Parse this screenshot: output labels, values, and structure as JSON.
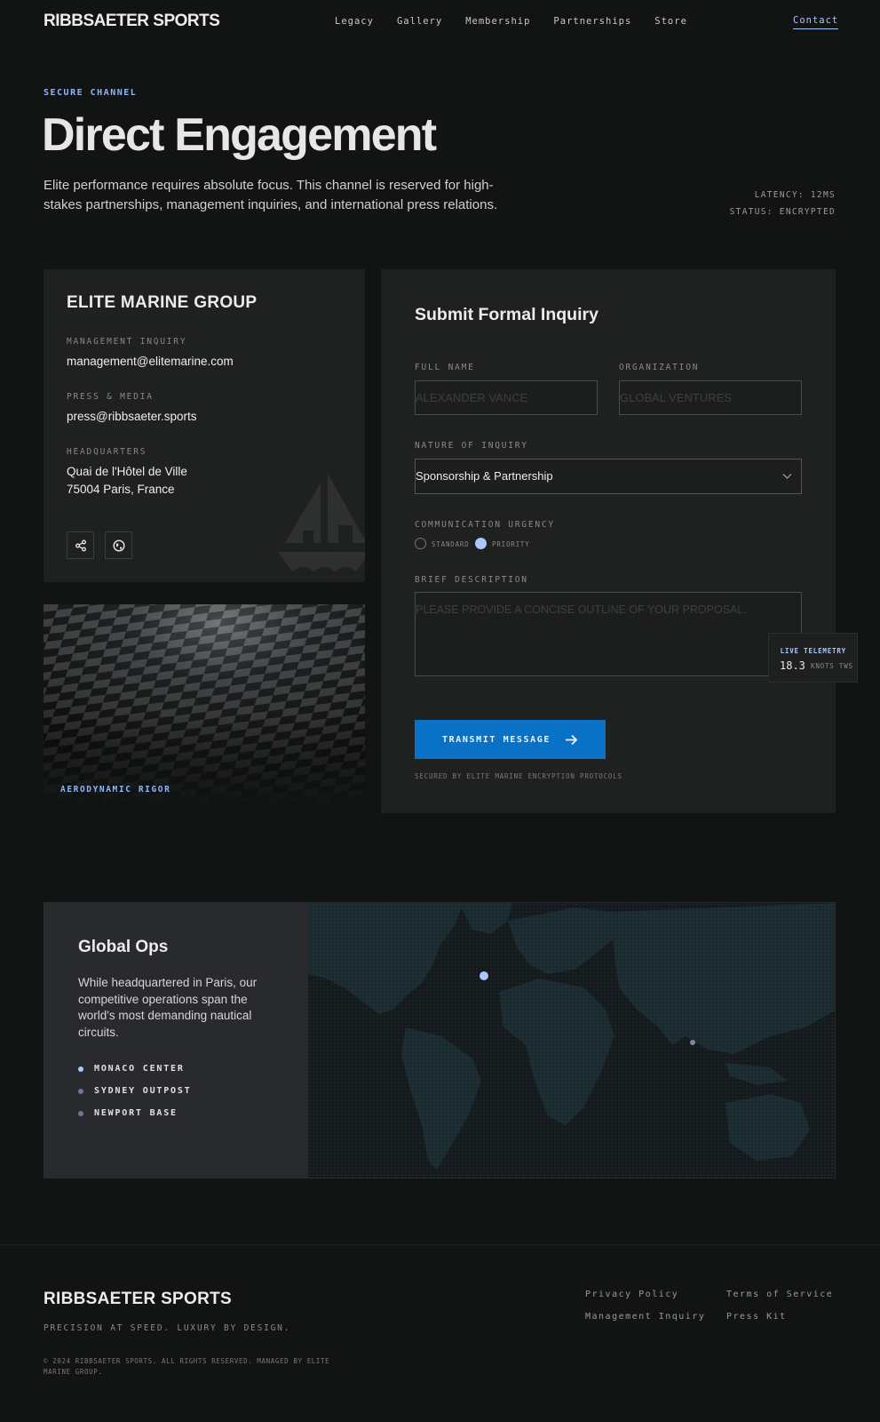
{
  "nav": {
    "brand": "RIBBSAETER SPORTS",
    "links": [
      "Legacy",
      "Gallery",
      "Membership",
      "Partnerships",
      "Store"
    ],
    "contact": "Contact"
  },
  "hero": {
    "eyebrow": "SECURE CHANNEL",
    "title": "Direct Engagement",
    "description": "Elite performance requires absolute focus. This channel is reserved for high-stakes partnerships, management inquiries, and international press relations.",
    "latency": "LATENCY: 12MS",
    "status": "STATUS: ENCRYPTED"
  },
  "contact_card": {
    "title": "ELITE MARINE GROUP",
    "management_label": "MANAGEMENT INQUIRY",
    "management_email": "management@elitemarine.com",
    "press_label": "PRESS & MEDIA",
    "press_email": "press@ribbsaeter.sports",
    "hq_label": "HEADQUARTERS",
    "hq_line1": "Quai de l'Hôtel de Ville",
    "hq_line2": "75004 Paris, France",
    "icons": [
      "share-icon",
      "globe-icon"
    ]
  },
  "image_card": {
    "caption": "AERODYNAMIC RIGOR"
  },
  "form": {
    "title": "Submit Formal Inquiry",
    "full_name_label": "FULL NAME",
    "full_name_placeholder": "ALEXANDER VANCE",
    "organization_label": "ORGANIZATION",
    "organization_placeholder": "GLOBAL VENTURES",
    "nature_label": "NATURE OF INQUIRY",
    "nature_value": "Sponsorship & Partnership",
    "urgency_label": "COMMUNICATION URGENCY",
    "urgency_options": [
      "STANDARD",
      "PRIORITY"
    ],
    "urgency_selected": "PRIORITY",
    "description_label": "BRIEF DESCRIPTION",
    "description_placeholder": "PLEASE PROVIDE A CONCISE OUTLINE OF YOUR PROPOSAL.",
    "submit_label": "TRANSMIT MESSAGE",
    "secured_note": "SECURED BY ELITE MARINE ENCRYPTION PROTOCOLS"
  },
  "telemetry": {
    "label": "LIVE TELEMETRY",
    "value": "18.3",
    "unit": "KNOTS TWS"
  },
  "global_ops": {
    "title": "Global Ops",
    "description": "While headquartered in Paris, our competitive operations span the world's most demanding nautical circuits.",
    "locations": [
      "MONACO CENTER",
      "SYDNEY OUTPOST",
      "NEWPORT BASE"
    ]
  },
  "footer": {
    "brand": "RIBBSAETER SPORTS",
    "tagline": "PRECISION AT SPEED. LUXURY BY DESIGN.",
    "copyright": "© 2024 RIBBSAETER SPORTS. ALL RIGHTS RESERVED. MANAGED BY ELITE MARINE GROUP.",
    "links": [
      "Privacy Policy",
      "Terms of Service",
      "Management Inquiry",
      "Press Kit"
    ]
  },
  "colors": {
    "background": "#121414",
    "accent": "#a9c7ff",
    "button": "#0a72c6",
    "panel": "#1f2020"
  }
}
